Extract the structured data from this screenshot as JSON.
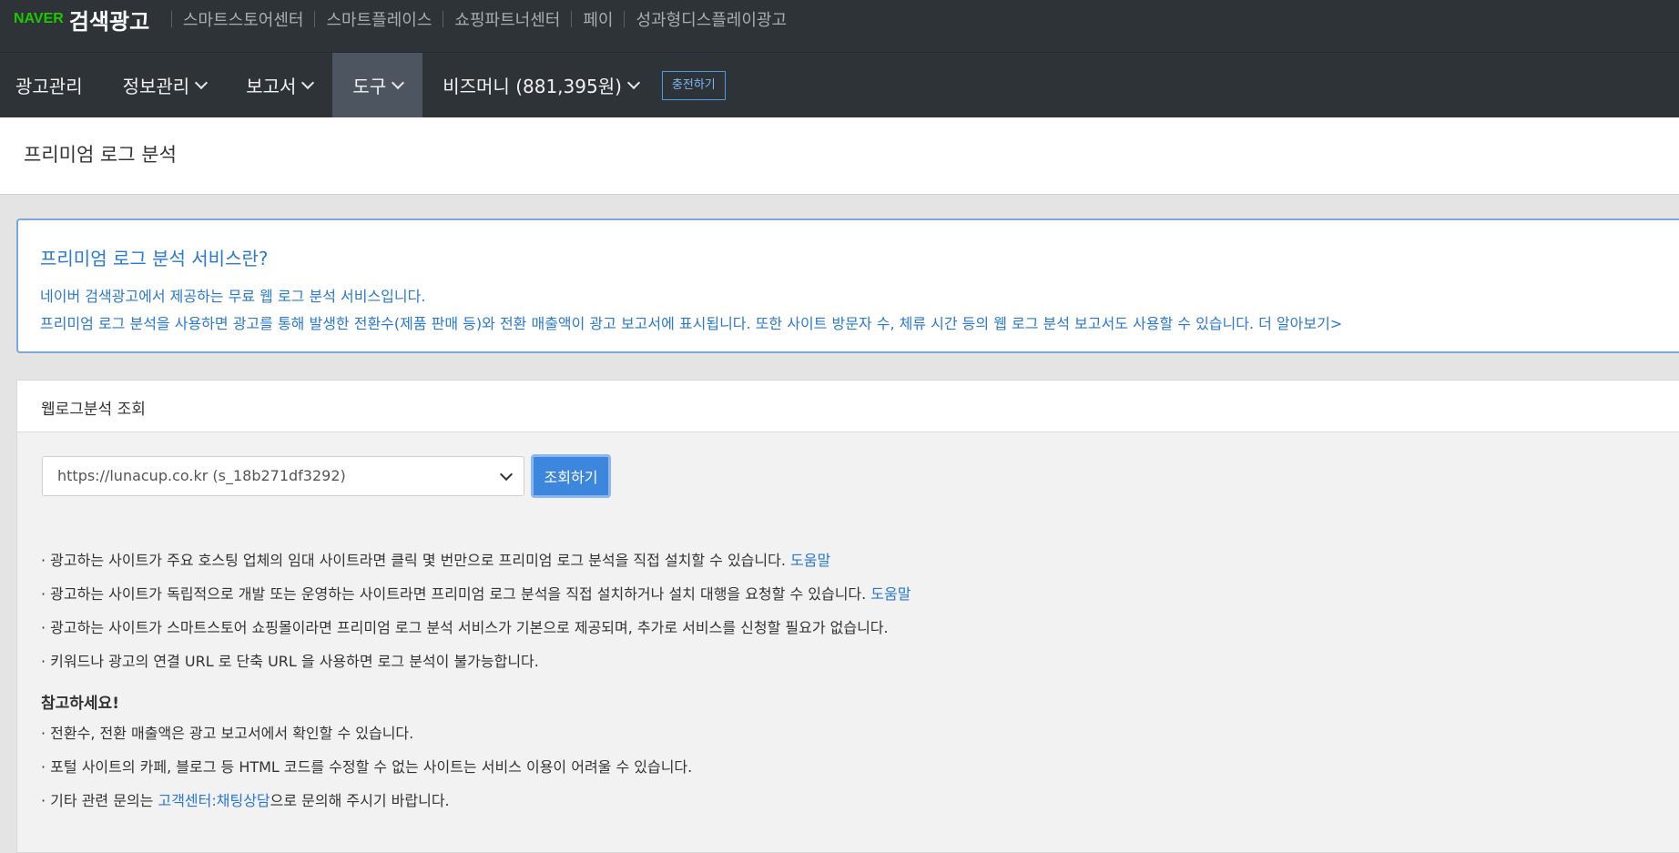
{
  "header": {
    "logo_naver": "NAVER",
    "logo_brand": "검색광고",
    "site_links": [
      "스마트스토어센터",
      "스마트플레이스",
      "쇼핑파트너센터",
      "페이",
      "성과형디스플레이광고"
    ]
  },
  "nav": {
    "ad_manage": "광고관리",
    "info_manage": "정보관리",
    "report": "보고서",
    "tools": "도구",
    "biz_money": "비즈머니 (881,395원)",
    "charge_button": "충전하기"
  },
  "page": {
    "title": "프리미엄 로그 분석"
  },
  "info": {
    "heading": "프리미엄 로그 분석 서비스란?",
    "line1": "네이버 검색광고에서 제공하는 무료 웹 로그 분석 서비스입니다.",
    "line2": "프리미엄 로그 분석을 사용하면 광고를 통해 발생한 전환수(제품 판매 등)와 전환 매출액이 광고 보고서에 표시됩니다. 또한 사이트 방문자 수, 체류 시간 등의 웹 로그 분석 보고서도 사용할 수 있습니다. 더 알아보기>"
  },
  "panel": {
    "title": "웹로그분석 조회",
    "site_select_value": "https://lunacup.co.kr (s_18b271df3292)",
    "query_button": "조회하기",
    "bullets": [
      {
        "text": "· 광고하는 사이트가 주요 호스팅 업체의 임대 사이트라면 클릭 몇 번만으로 프리미엄 로그 분석을 직접 설치할 수 있습니다. ",
        "link": "도움말"
      },
      {
        "text": "· 광고하는 사이트가 독립적으로 개발 또는 운영하는 사이트라면 프리미엄 로그 분석을 직접 설치하거나 설치 대행을 요청할 수 있습니다. ",
        "link": "도움말"
      },
      {
        "text": "· 광고하는 사이트가 스마트스토어 쇼핑몰이라면 프리미엄 로그 분석 서비스가 기본으로 제공되며, 추가로 서비스를 신청할 필요가 없습니다.",
        "link": ""
      },
      {
        "text": "· 키워드나 광고의 연결 URL 로 단축 URL 을 사용하면 로그 분석이 불가능합니다.",
        "link": ""
      }
    ],
    "note_heading": "참고하세요!",
    "notes": [
      {
        "text": "· 전환수, 전환 매출액은 광고 보고서에서 확인할 수 있습니다.",
        "link": "",
        "after": ""
      },
      {
        "text": "· 포털 사이트의 카페, 블로그 등 HTML 코드를 수정할 수 없는 사이트는 서비스 이용이 어려울 수 있습니다.",
        "link": "",
        "after": ""
      },
      {
        "text": "· 기타 관련 문의는 ",
        "link": "고객센터:채팅상담",
        "after": "으로 문의해 주시기 바랍니다."
      }
    ]
  },
  "colors": {
    "topbar_bg": "#2e3338",
    "active_tab_bg": "#4d5660",
    "naver_green": "#1ec800",
    "link_blue": "#2a78d0",
    "button_blue": "#3d86dd"
  }
}
